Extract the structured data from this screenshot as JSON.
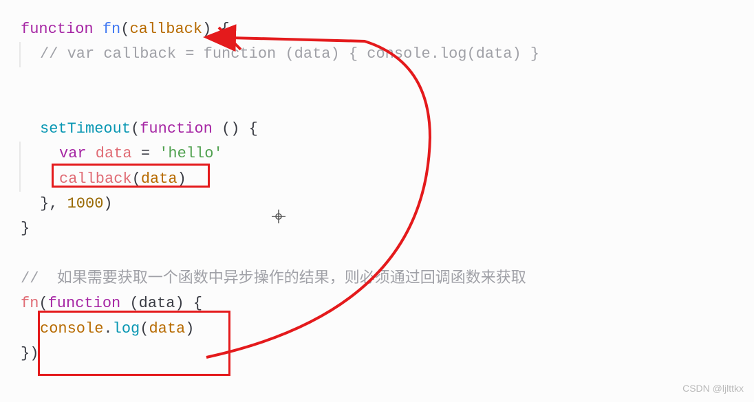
{
  "code": {
    "line1": {
      "kw_function": "function",
      "fn_name": "fn",
      "param": "callback",
      "open_paren": "(",
      "close_paren": ")",
      "open_brace": " {"
    },
    "line2": {
      "comment": "// var callback = function (data) { console.log(data) }"
    },
    "line3": "",
    "line4": "",
    "line5": {
      "set_timeout": "setTimeout",
      "open_paren": "(",
      "kw_function": "function",
      "params": " ()",
      "open_brace": " {"
    },
    "line6": {
      "kw_var": "var",
      "var_name": " data",
      "equals": " = ",
      "string": "'hello'"
    },
    "line7": {
      "callback": "callback",
      "open_paren": "(",
      "arg": "data",
      "close_paren": ")"
    },
    "line8": {
      "close_brace": "}",
      "comma": ", ",
      "num": "1000",
      "close_paren": ")"
    },
    "line9": {
      "close_brace": "}"
    },
    "line10": "",
    "line11": {
      "comment": "//  如果需要获取一个函数中异步操作的结果，则必须通过回调函数来获取"
    },
    "line12": {
      "fn_call": "fn",
      "open_paren": "(",
      "kw_function": "function",
      "params": " (data)",
      "open_brace": " {"
    },
    "line13": {
      "console": "console",
      "dot": ".",
      "log": "log",
      "open_paren": "(",
      "arg": "data",
      "close_paren": ")"
    },
    "line14": {
      "close_brace": "}",
      "close_paren": ")"
    }
  },
  "watermark": "CSDN @ljlttkx"
}
